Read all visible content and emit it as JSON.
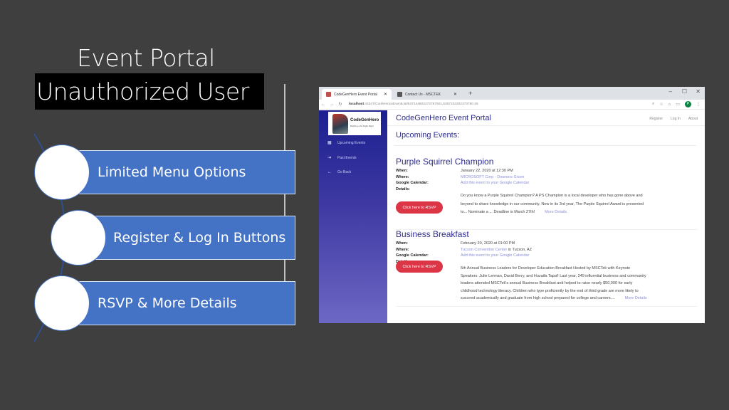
{
  "slide": {
    "title": "Event Portal",
    "subtitle": "Unauthorized User",
    "points": [
      {
        "label": "Limited Menu Options"
      },
      {
        "label": "Register & Log In Buttons"
      },
      {
        "label": "RSVP & More Details"
      }
    ],
    "colors": {
      "background": "#3f3f3f",
      "bar": "#4472c4",
      "highlight": "#000000"
    }
  },
  "browser": {
    "tabs": [
      {
        "label": "CodeGenHero Event Portal",
        "active": true,
        "close": "✕"
      },
      {
        "label": "Contact Us - MSCTEK",
        "active": false,
        "close": "✕"
      }
    ],
    "new_tab": "+",
    "window_controls": {
      "minimize": "–",
      "maximize": "☐",
      "close": "✕"
    },
    "nav": {
      "back": "←",
      "forward": "→",
      "reload": "↻",
      "lock": "🔒"
    },
    "url_host": "localhost",
    "url_rest": ":44347/ConferenceEventList/637144602273757501,6387232202373750 26",
    "profile_initial": "P"
  },
  "app": {
    "logo_brand": "CodeGenHero",
    "logo_tagline": "Building a bit Right Right",
    "title": "CodeGenHero Event Portal",
    "top_nav": [
      "Register",
      "Log In",
      "About"
    ],
    "sidebar": [
      {
        "icon": "▦",
        "label": "Upcoming Events"
      },
      {
        "icon": "⇥",
        "label": "Past Events"
      },
      {
        "icon": "←",
        "label": "Go Back"
      }
    ],
    "section_title": "Upcoming Events:",
    "labels": {
      "when": "When:",
      "where": "Where:",
      "calendar": "Google Calendar:",
      "details": "Details:"
    },
    "events": [
      {
        "title": "Purple Squirrel Champion",
        "when": "January 22, 2020 at 12:30 PM",
        "where_link": "MICROSOFT Corp - Downers Grove",
        "where_text": "",
        "calendar": "Add this event to your Google Calendar",
        "details": "Do you know a Purple Squirrel Champion? A PS Champion is a local developer who has gone above and beyond to share knowledge in our community. Now in its 3rd year, The Purple Squirrel Award is presented to... Nominate a ... Deadline is March 27th!",
        "more": "More Details",
        "rsvp": "Click here to RSVP"
      },
      {
        "title": "Business Breakfast",
        "when": "February 20, 2020 at 01:00 PM",
        "where_link": "Tucson Convention Center",
        "where_text": " in Tucson, AZ",
        "calendar": "Add this event to your Google Calendar",
        "details": "5th Annual Business Leaders for Developer Education Breakfast Hosted by MSCTek with Keynote Speakers: Julie Lerman, David Berry, and Huzaifa Tapal! Last year, 249 influential business and community leaders attended MSCTek's annual Business Breakfast and helped to raise nearly $50,000 for early childhood technology literacy. Children who type proficiently by the end of third grade are more likely to succeed academically and graduate from high school prepared for college and careers....",
        "more": "More Details",
        "rsvp": "Click here to RSVP"
      }
    ]
  }
}
